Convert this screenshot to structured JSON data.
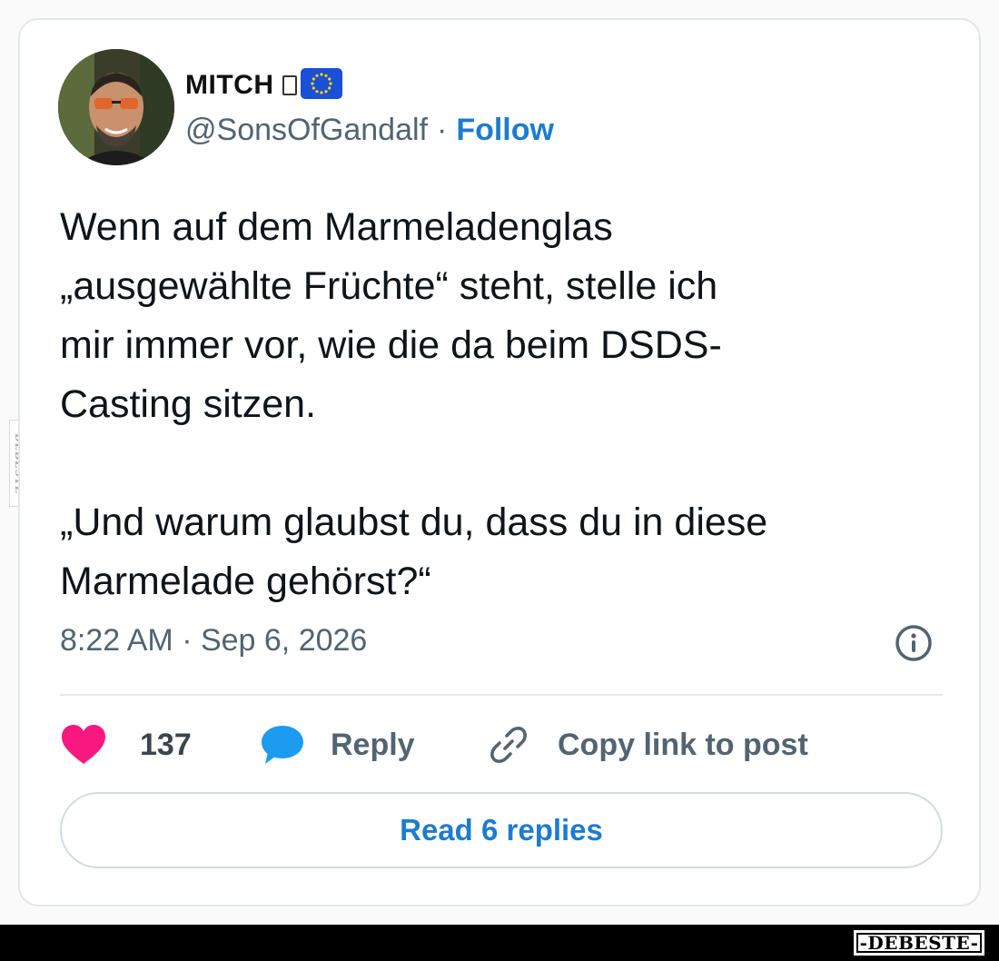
{
  "author": {
    "display_name": "MITCH",
    "handle": "@SonsOfGandalf",
    "separator": "·",
    "follow_label": "Follow",
    "avatar_icon": "user-avatar-photo",
    "flag_icon": "eu-flag-icon"
  },
  "tweet": {
    "text_lines": [
      "Wenn auf dem Marmeladenglas",
      "„ausgewählte Früchte“ steht, stelle ich",
      "mir immer vor, wie die da beim DSDS-",
      "Casting sitzen.",
      "„Und warum glaubst du, dass du in diese",
      "Marmelade gehörst?“"
    ],
    "timestamp": "8:22 AM · Sep 6, 2026"
  },
  "actions": {
    "like_count": "137",
    "reply_label": "Reply",
    "copy_link_label": "Copy link to post"
  },
  "read_replies_label": "Read 6 replies",
  "watermark": {
    "side_text": "DEBESTE",
    "bottom_text": "-DEBESTE-"
  },
  "colors": {
    "accent": "#1d7ccf",
    "like": "#f91880",
    "reply_bubble": "#1d9bf0",
    "muted_text": "#536471"
  }
}
